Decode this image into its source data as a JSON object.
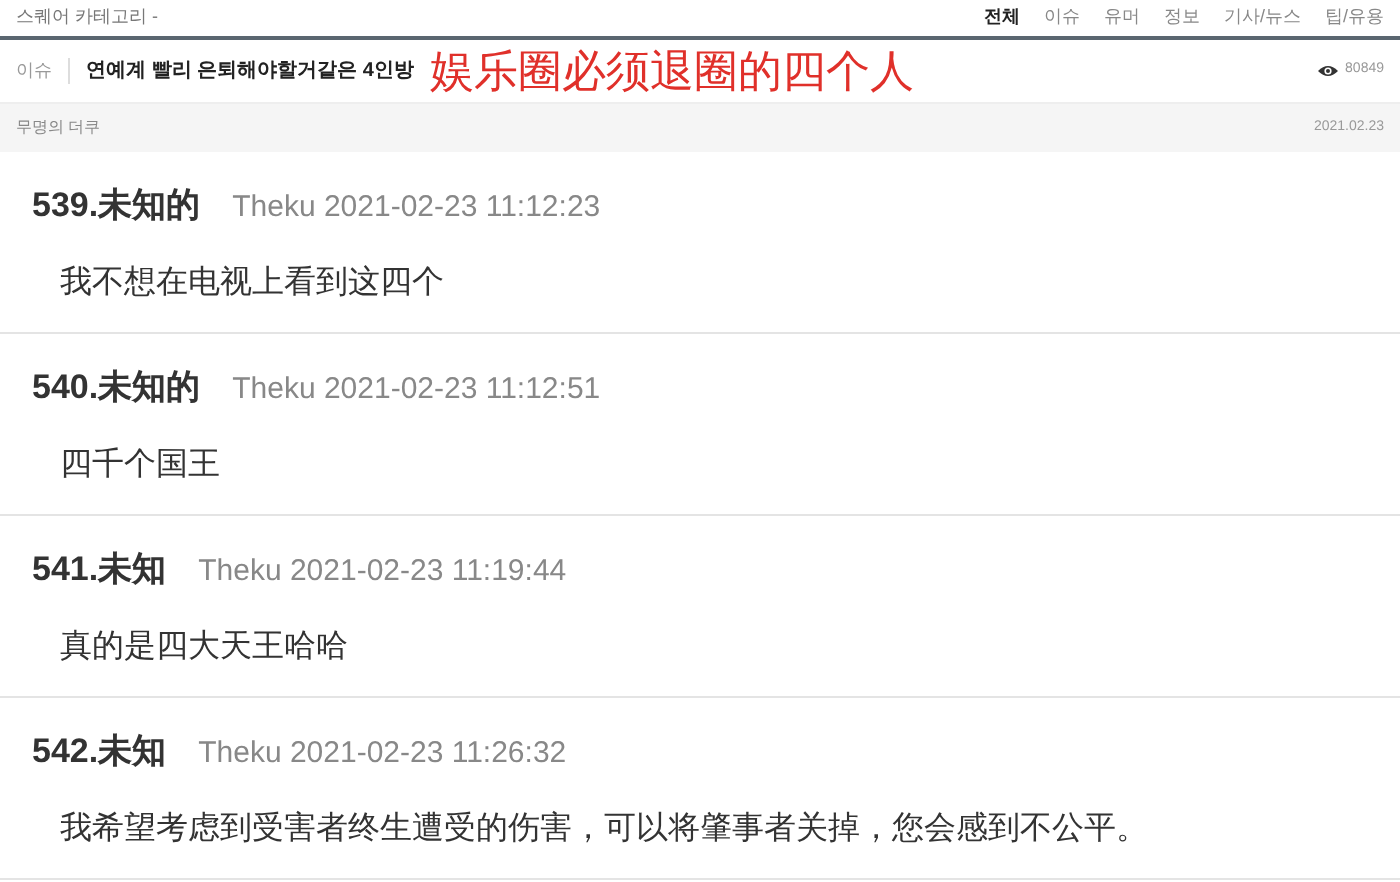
{
  "header": {
    "breadcrumb": "스퀘어 카테고리 -",
    "tabs": [
      {
        "label": "전체",
        "selected": true
      },
      {
        "label": "이슈",
        "selected": false
      },
      {
        "label": "유머",
        "selected": false
      },
      {
        "label": "정보",
        "selected": false
      },
      {
        "label": "기사/뉴스",
        "selected": false
      },
      {
        "label": "팁/유용",
        "selected": false
      }
    ]
  },
  "post": {
    "category": "이슈",
    "title": "연예계 빨리 은퇴해야할거같은 4인방",
    "caption": "娱乐圈必须退圈的四个人",
    "views": "80849",
    "author": "무명의 더쿠",
    "date": "2021.02.23"
  },
  "comments": [
    {
      "number": "539.",
      "name": "未知的",
      "user": "Theku",
      "time": "2021-02-23 11:12:23",
      "text": "我不想在电视上看到这四个"
    },
    {
      "number": "540.",
      "name": "未知的",
      "user": "Theku",
      "time": "2021-02-23 11:12:51",
      "text": "四千个国王"
    },
    {
      "number": "541.",
      "name": "未知",
      "user": "Theku",
      "time": "2021-02-23 11:19:44",
      "text": "真的是四大天王哈哈"
    },
    {
      "number": "542.",
      "name": "未知",
      "user": "Theku",
      "time": "2021-02-23 11:26:32",
      "text": "我希望考虑到受害者终生遭受的伤害，可以将肇事者关掉，您会感到不公平。"
    }
  ]
}
